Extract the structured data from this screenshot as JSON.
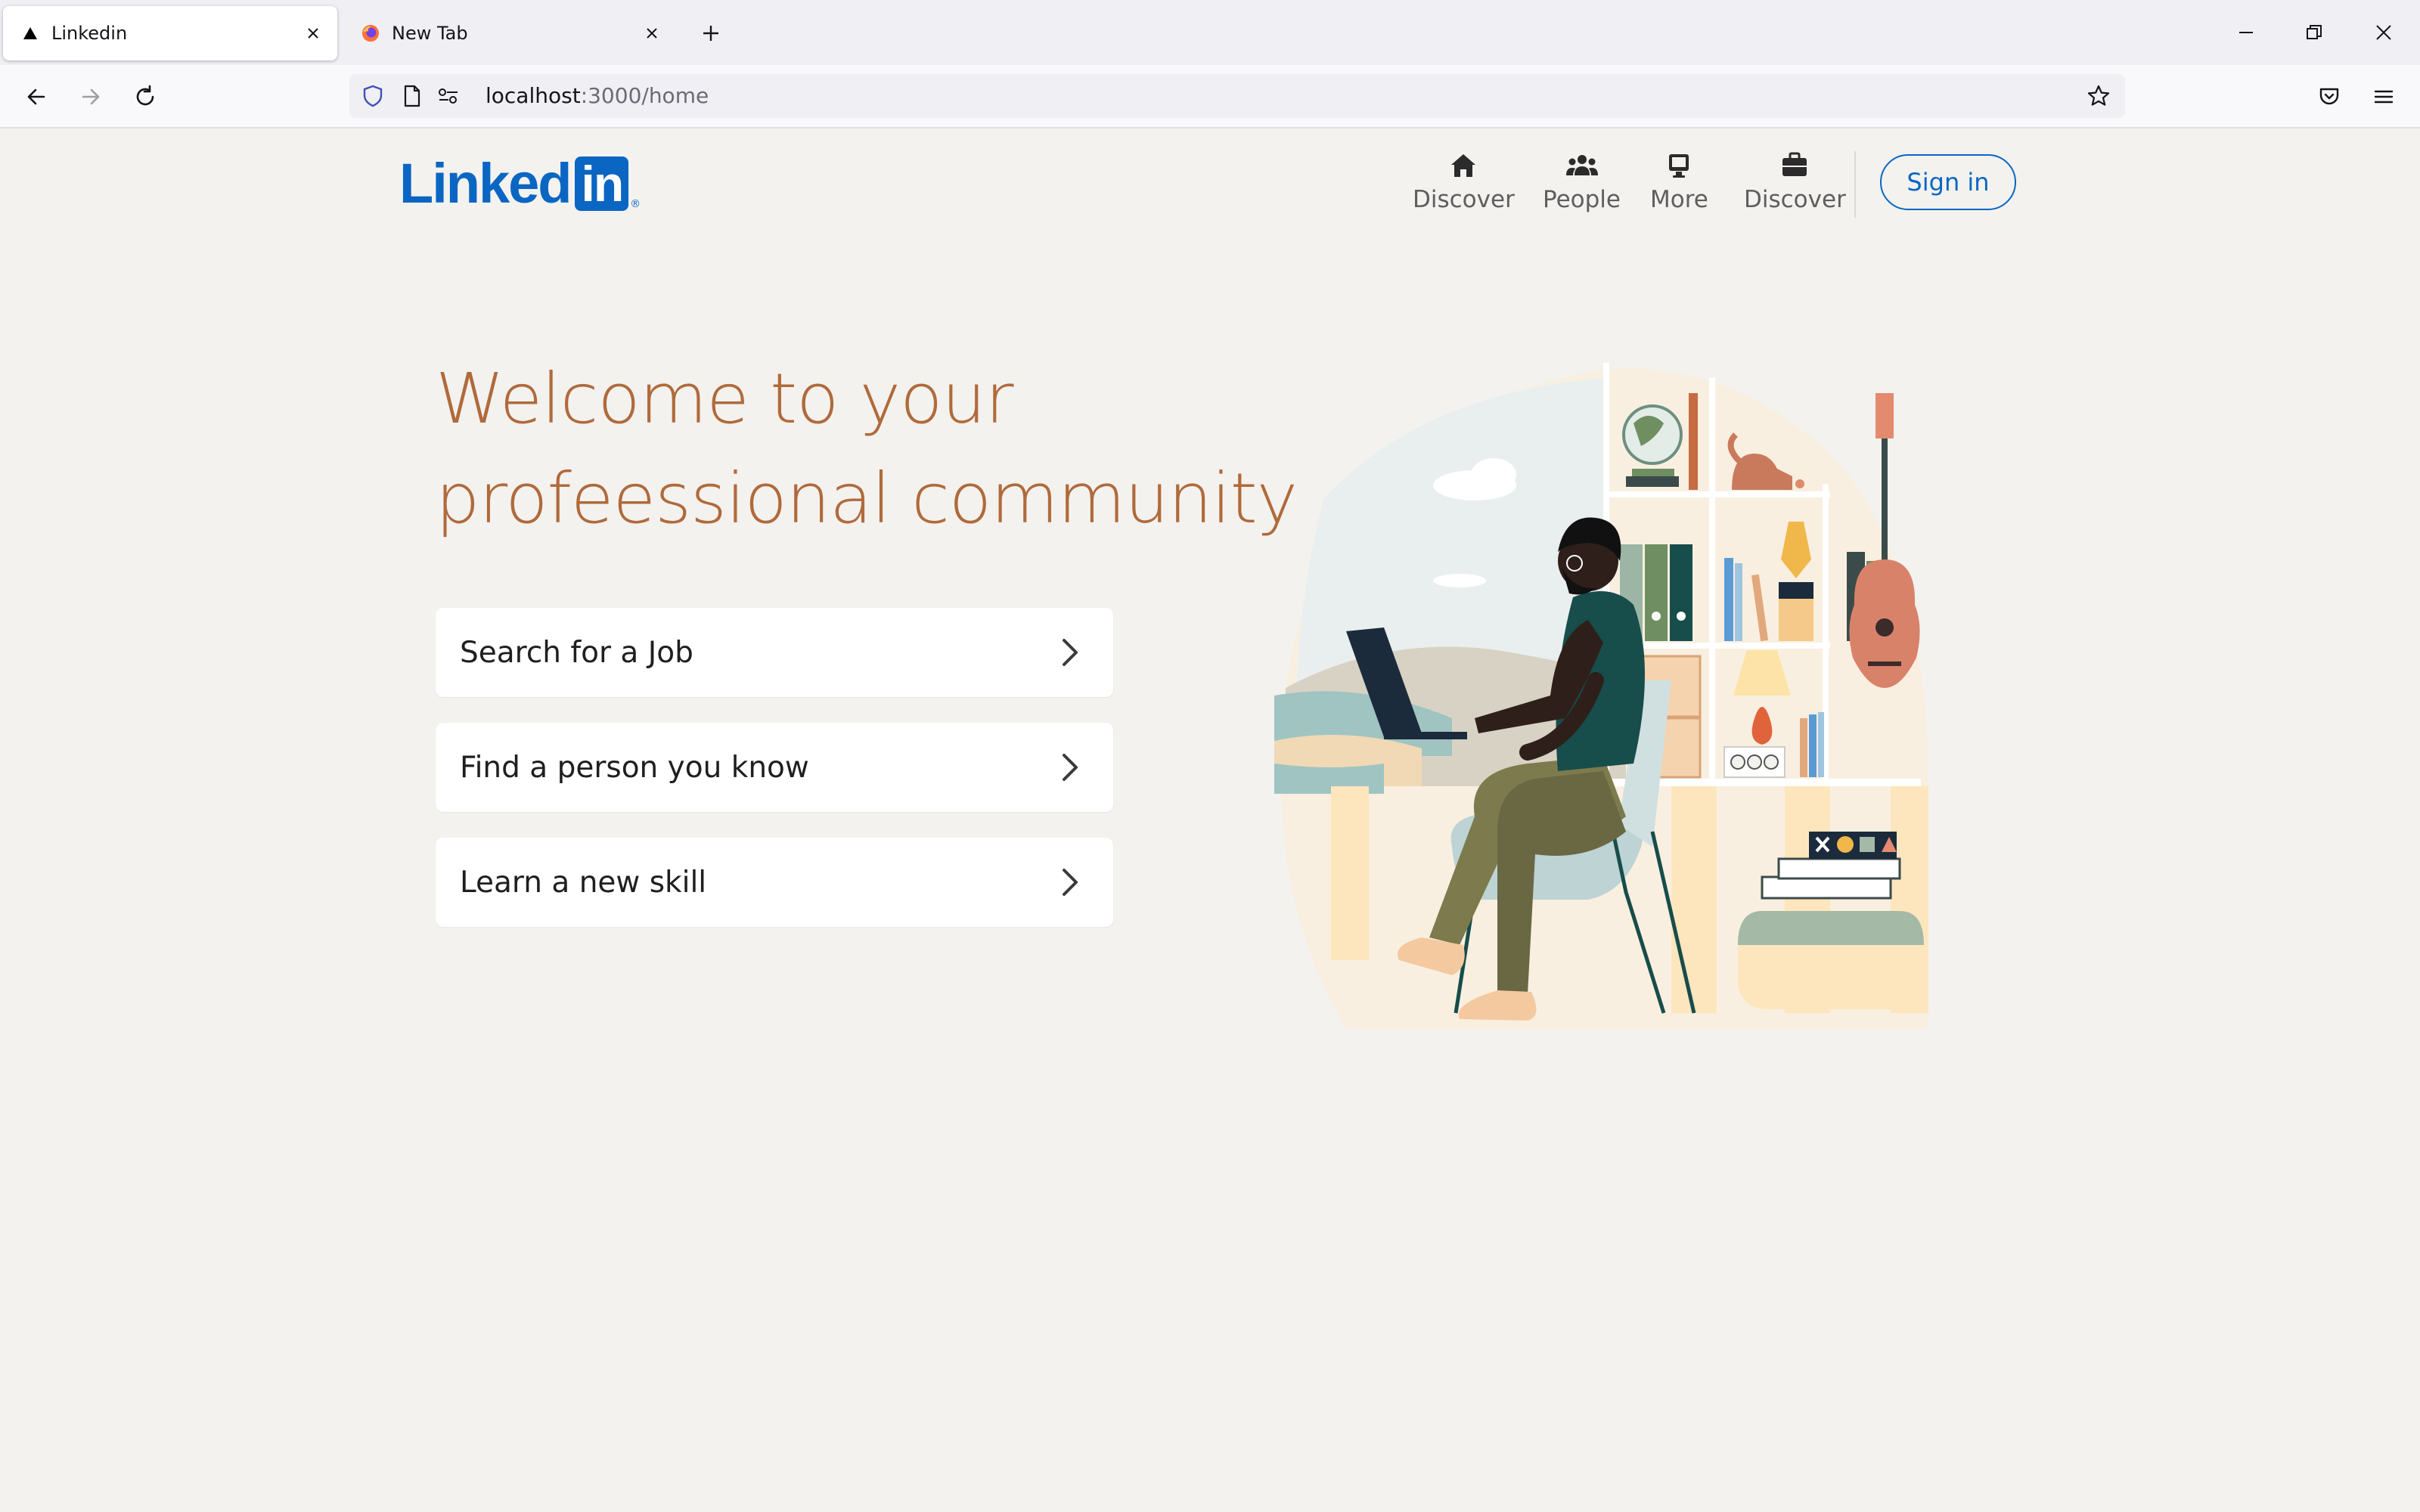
{
  "browser": {
    "tabs": [
      {
        "title": "Linkedin",
        "icon": "triangle-icon",
        "active": true
      },
      {
        "title": "New Tab",
        "icon": "firefox-icon",
        "active": false
      }
    ],
    "url": {
      "host": "localhost",
      "path": ":3000/home"
    }
  },
  "header": {
    "logo": {
      "word": "Linked",
      "box": "in",
      "reg": "®"
    },
    "nav": [
      {
        "label": "Discover",
        "icon": "home-icon"
      },
      {
        "label": "People",
        "icon": "people-icon"
      },
      {
        "label": "More",
        "icon": "monitor-icon"
      },
      {
        "label": "Discover",
        "icon": "briefcase-icon"
      }
    ],
    "sign_in": "Sign in"
  },
  "hero": {
    "line1": "Welcome to your",
    "line2": "profeessional community"
  },
  "options": [
    {
      "label": "Search for a Job"
    },
    {
      "label": "Find a person you know"
    },
    {
      "label": "Learn a new skill"
    }
  ],
  "colors": {
    "brand": "#0a66c2",
    "headline": "#b06a3b",
    "background": "#f3f2ef"
  }
}
